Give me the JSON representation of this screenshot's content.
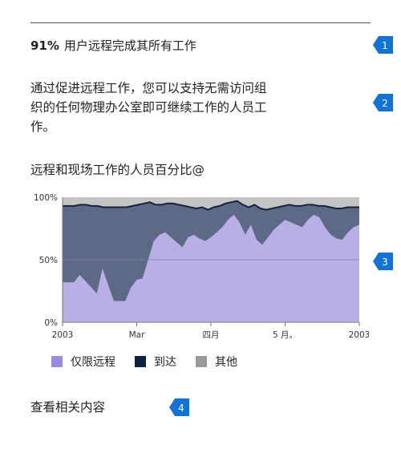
{
  "stat": {
    "percent": "91%",
    "text": "用户远程完成其所有工作"
  },
  "description": "通过促进远程工作，您可以支持无需访问组织的任何物理办公室即可继续工作的人员工作。",
  "chart_title": "远程和现场工作的人员百分比@",
  "related_link": "查看相关内容",
  "callouts": [
    "1",
    "2",
    "3",
    "4"
  ],
  "legend": [
    {
      "label": "仅限远程",
      "color": "#9b8ae0"
    },
    {
      "label": "到达",
      "color": "#0f2340"
    },
    {
      "label": "其他",
      "color": "#9a9a9a"
    }
  ],
  "chart_data": {
    "type": "area",
    "title": "远程和现场工作的人员百分比@",
    "x_ticks": [
      "2003",
      "Mar",
      "四月",
      "5 月。",
      "2003"
    ],
    "y_ticks": [
      "100%",
      "50%",
      "0%"
    ],
    "ylim": [
      0,
      100
    ],
    "legend_position": "bottom",
    "x_count": 40,
    "series": [
      {
        "name": "仅限远程",
        "color": "#b9aee6",
        "values": [
          32,
          32,
          32,
          38,
          33,
          28,
          23,
          43,
          30,
          17,
          17,
          17,
          28,
          34,
          35,
          50,
          65,
          70,
          72,
          68,
          64,
          60,
          68,
          70,
          67,
          65,
          68,
          72,
          76,
          82,
          86,
          80,
          70,
          78,
          66,
          62,
          68,
          74,
          78,
          82,
          80,
          78,
          76,
          82,
          86,
          84,
          76,
          70,
          67,
          66,
          72,
          76,
          78
        ]
      },
      {
        "name": "到达",
        "color": "#5c6a85",
        "values": [
          93,
          93,
          93,
          94,
          94,
          93,
          93,
          92,
          92,
          92,
          92,
          92,
          93,
          94,
          95,
          96,
          94,
          94,
          95,
          95,
          94,
          93,
          92,
          91,
          92,
          90,
          92,
          93,
          95,
          96,
          97,
          94,
          92,
          94,
          91,
          90,
          91,
          92,
          93,
          94,
          93,
          93,
          94,
          94,
          93,
          93,
          92,
          91,
          91,
          92,
          92,
          92
        ]
      },
      {
        "name": "其他",
        "color": "#c4c4c4",
        "values": [
          100,
          100,
          100,
          100,
          100,
          100,
          100,
          100,
          100,
          100,
          100,
          100,
          100,
          100,
          100,
          100,
          100,
          100,
          100,
          100,
          100,
          100,
          100,
          100,
          100,
          100,
          100,
          100,
          100,
          100,
          100,
          100,
          100,
          100,
          100,
          100,
          100,
          100,
          100,
          100,
          100,
          100,
          100,
          100,
          100,
          100,
          100,
          100,
          100,
          100,
          100,
          100
        ]
      }
    ]
  }
}
